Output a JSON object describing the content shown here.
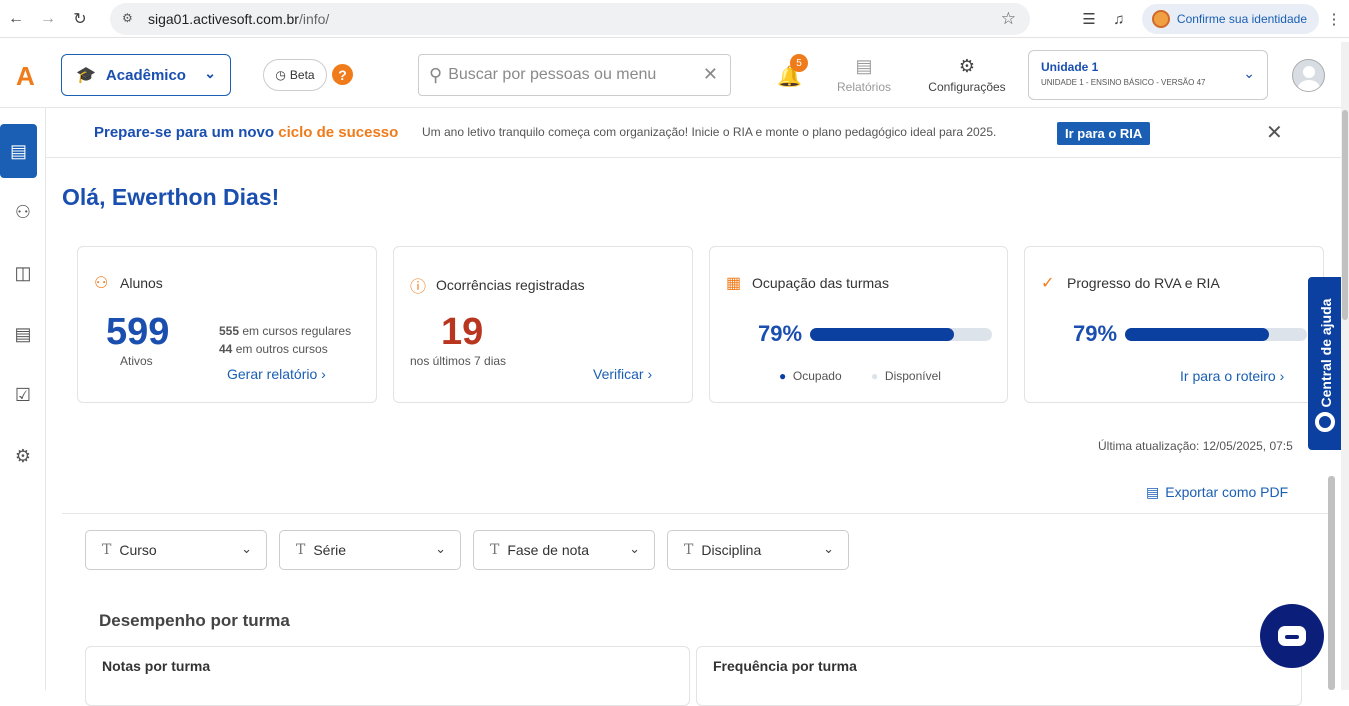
{
  "browser": {
    "url_host": "siga01.activesoft.com.br",
    "url_path": "/info/",
    "identity_label": "Confirme sua identidade"
  },
  "header": {
    "logo_letter": "A",
    "module_label": "Acadêmico",
    "beta_label": "Beta",
    "help_label": "?",
    "search_placeholder": "Buscar por pessoas ou menu",
    "notifications_count": "5",
    "reports_label": "Relatórios",
    "settings_label": "Configurações",
    "unit_name": "Unidade 1",
    "unit_detail": "UNIDADE 1 - ENSINO BÁSICO - VERSÃO 47"
  },
  "banner": {
    "title_prefix": "Prepare-se para um novo ",
    "title_highlight": "ciclo de sucesso",
    "text": "Um ano letivo tranquilo começa com organização! Inicie o RIA e monte o plano pedagógico ideal para 2025.",
    "button_label": "Ir para o RIA"
  },
  "greeting": "Olá, Ewerthon Dias!",
  "cards": {
    "students": {
      "title": "Alunos",
      "value": "599",
      "sub": "Ativos",
      "regular_count": "555",
      "regular_text": " em cursos regulares",
      "other_count": "44",
      "other_text": " em outros cursos",
      "link": "Gerar relatório"
    },
    "occurrences": {
      "title": "Ocorrências registradas",
      "value": "19",
      "sub": "nos últimos 7 dias",
      "link": "Verificar"
    },
    "occupancy": {
      "title": "Ocupação das turmas",
      "percent_label": "79%",
      "fill_fraction": 0.79,
      "legend_occupied": "Ocupado",
      "legend_available": "Disponível"
    },
    "progress": {
      "title": "Progresso do RVA e RIA",
      "percent_label": "79%",
      "fill_fraction": 0.79,
      "link": "Ir para o roteiro"
    }
  },
  "last_update": "Última atualização: 12/05/2025, 07:5",
  "export_label": "Exportar como PDF",
  "filters": [
    "Curso",
    "Série",
    "Fase de nota",
    "Disciplina"
  ],
  "section_title": "Desempenho por turma",
  "panels": {
    "grades": "Notas por turma",
    "attendance": "Frequência por turma"
  },
  "help_tab_label": "Central de ajuda",
  "colors": {
    "primary": "#1a5fb4",
    "dark_blue": "#0b3fa0",
    "accent_orange": "#f07b1a",
    "alert_red": "#b8361f"
  }
}
